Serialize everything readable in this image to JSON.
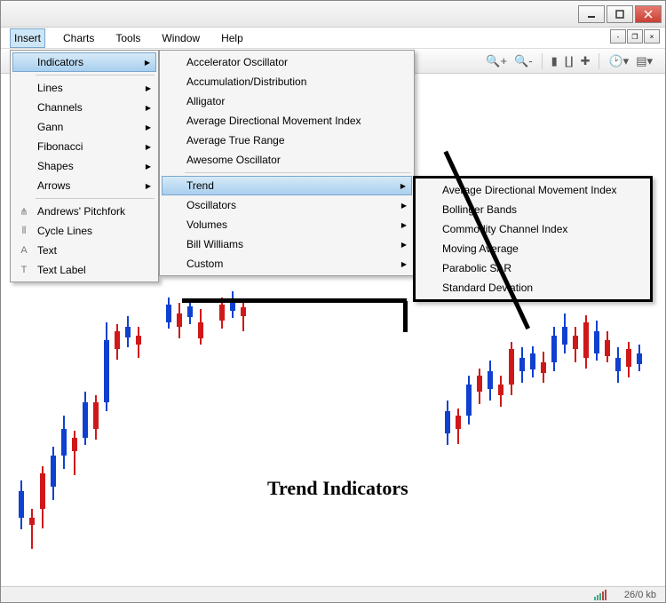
{
  "menubar": {
    "items": [
      "Insert",
      "Charts",
      "Tools",
      "Window",
      "Help"
    ],
    "active_index": 0
  },
  "insert_menu": {
    "top": [
      {
        "label": "Indicators",
        "submenu": true,
        "selected": true
      },
      {
        "label": "Lines",
        "submenu": true
      },
      {
        "label": "Channels",
        "submenu": true
      },
      {
        "label": "Gann",
        "submenu": true
      },
      {
        "label": "Fibonacci",
        "submenu": true
      },
      {
        "label": "Shapes",
        "submenu": true
      },
      {
        "label": "Arrows",
        "submenu": true
      }
    ],
    "bottom": [
      {
        "label": "Andrews' Pitchfork",
        "icon": "⋔"
      },
      {
        "label": "Cycle Lines",
        "icon": "⦀"
      },
      {
        "label": "Text",
        "icon": "A"
      },
      {
        "label": "Text Label",
        "icon": "T"
      }
    ]
  },
  "indicators_menu": {
    "top": [
      {
        "label": "Accelerator Oscillator"
      },
      {
        "label": "Accumulation/Distribution"
      },
      {
        "label": "Alligator"
      },
      {
        "label": "Average Directional Movement Index"
      },
      {
        "label": "Average True Range"
      },
      {
        "label": "Awesome Oscillator"
      }
    ],
    "bottom": [
      {
        "label": "Trend",
        "submenu": true,
        "selected": true
      },
      {
        "label": "Oscillators",
        "submenu": true
      },
      {
        "label": "Volumes",
        "submenu": true
      },
      {
        "label": "Bill Williams",
        "submenu": true
      },
      {
        "label": "Custom",
        "submenu": true
      }
    ]
  },
  "trend_menu": {
    "items": [
      {
        "label": "Average Directional Movement Index"
      },
      {
        "label": "Bollinger Bands"
      },
      {
        "label": "Commodity Channel Index"
      },
      {
        "label": "Moving Average"
      },
      {
        "label": "Parabolic SAR"
      },
      {
        "label": "Standard Deviation"
      }
    ]
  },
  "annotation": {
    "label": "Trend Indicators"
  },
  "statusbar": {
    "kb": "26/0 kb"
  },
  "toolbar_icons": [
    "zoom-in",
    "zoom-out",
    "bar-chart",
    "candle-chart",
    "line-chart",
    "",
    "shift",
    "period",
    "template"
  ]
}
